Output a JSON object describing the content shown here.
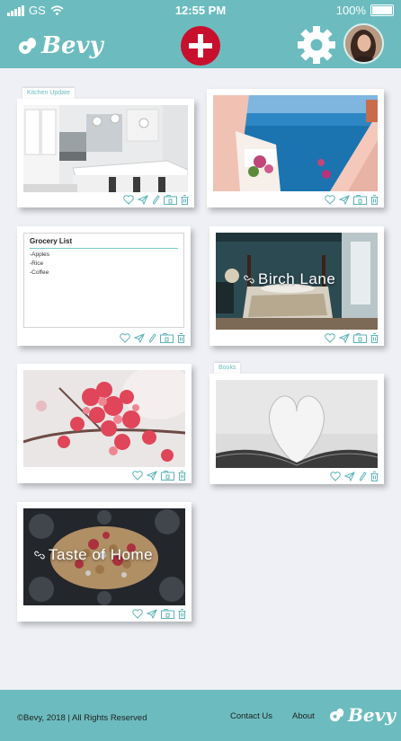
{
  "status": {
    "carrier": "GS",
    "time": "12:55 PM",
    "battery": "100%"
  },
  "header": {
    "logo_text": "Bevy",
    "add_icon": "plus-icon",
    "settings_icon": "gear-icon"
  },
  "cards": [
    {
      "tab": "Kitchen Update",
      "image": "kitchen"
    },
    {
      "tab": "",
      "image": "santorini"
    },
    {
      "type": "note",
      "note": {
        "title": "Grocery List",
        "items": [
          "-Apples",
          "-Rice",
          "-Coffee"
        ]
      }
    },
    {
      "title": "Birch Lane",
      "image": "bedroom"
    },
    {
      "tab": "",
      "image": "blossoms"
    },
    {
      "tab": "Books",
      "image": "book-pages"
    },
    {
      "title": "Taste of Home",
      "image": "waffle"
    }
  ],
  "card_actions": [
    "heart-icon",
    "send-icon",
    "pencil-icon",
    "board-icon",
    "trash-icon"
  ],
  "footer": {
    "copyright": "©Bevy, 2018 | All Rights Reserved",
    "contact": "Contact Us",
    "about": "About",
    "logo_text": "Bevy"
  },
  "colors": {
    "teal": "#6cbcbf",
    "red": "#c8102e",
    "background": "#eef0f5"
  }
}
